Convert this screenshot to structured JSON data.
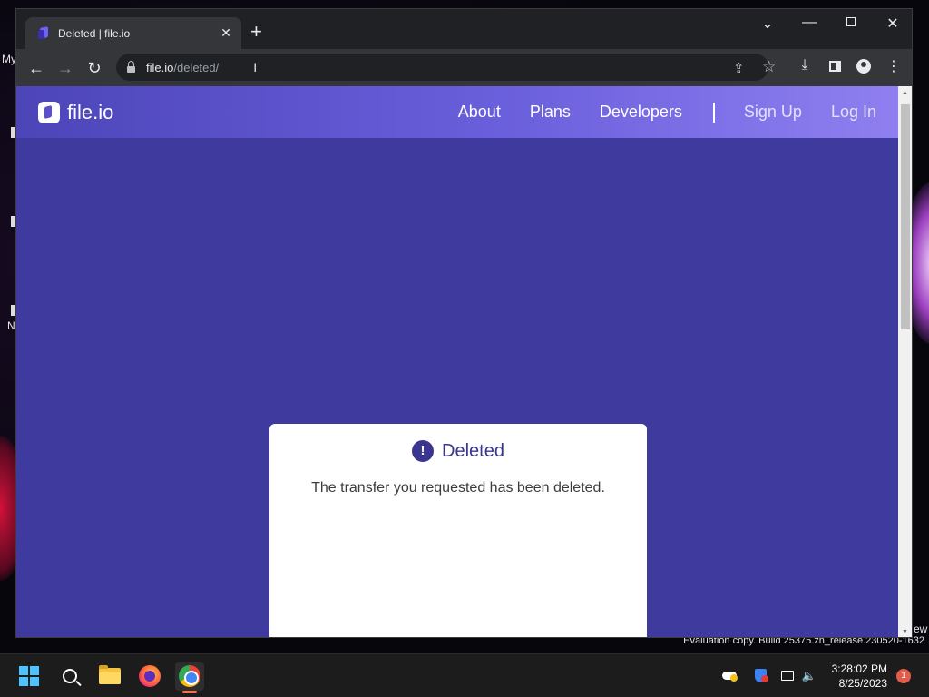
{
  "browser": {
    "tab_title": "Deleted | file.io",
    "tab_close": "✕",
    "new_tab": "+",
    "url_host": "file.io",
    "url_path": "/deleted/"
  },
  "window_controls": {
    "chevron": "⌄",
    "minimize": "—",
    "close": "✕"
  },
  "toolbar_icons": {
    "back": "←",
    "forward": "→",
    "reload": "↻",
    "share": "⇪",
    "star": "☆",
    "download": "⤓",
    "menu": "⋮",
    "cursor": "I"
  },
  "site": {
    "logo_text": "file.io",
    "nav": {
      "about": "About",
      "plans": "Plans",
      "developers": "Developers",
      "sign_up": "Sign Up",
      "log_in": "Log In"
    },
    "card": {
      "icon": "!",
      "title": "Deleted",
      "message": "The transfer you requested has been deleted."
    },
    "colors": {
      "background": "#3f3a9e",
      "accent": "#3a358f"
    }
  },
  "desktop": {
    "label_my": "My",
    "label_n": "N",
    "label_ew": "ew",
    "watermark": "Evaluation copy. Build 25375.zn_release.230520-1632"
  },
  "taskbar": {
    "time": "3:28:02 PM",
    "date": "8/25/2023",
    "notification_count": "1",
    "volume": "🔈"
  }
}
